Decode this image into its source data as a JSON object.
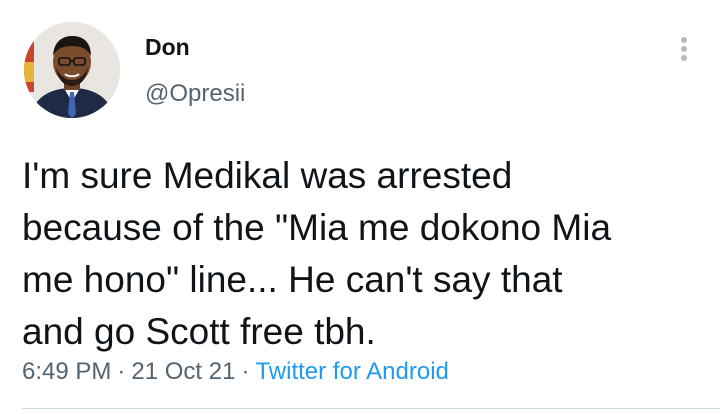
{
  "tweet": {
    "author": {
      "display_name": "Don",
      "handle": "@Opresii",
      "avatar": "profile-photo"
    },
    "more_icon": "more-vertical-icon",
    "text": "I'm sure Medikal was arrested\nbecause of the \"Mia me dokono Mia\nme hono\" line... He can't say that\nand go Scott free tbh.",
    "time": "6:49 PM",
    "separator": "·",
    "date": "21 Oct 21",
    "source": "Twitter for Android"
  },
  "colors": {
    "text": "#0f1419",
    "secondary": "#536471",
    "link": "#1d9bf0",
    "divider": "#cfd9de"
  }
}
